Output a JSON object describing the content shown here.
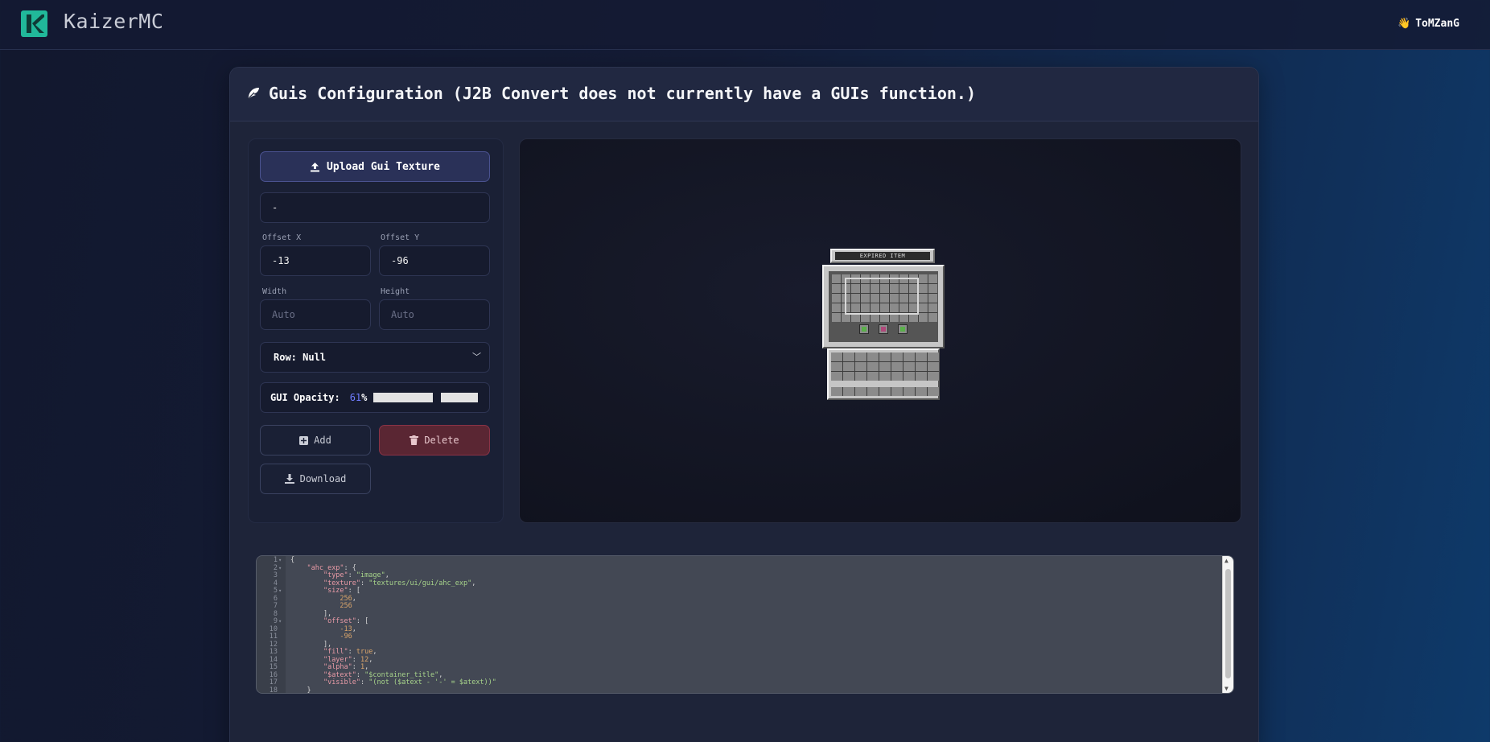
{
  "header": {
    "brand": "KaizerMC",
    "user": "ToMZanG",
    "user_icon": "wave-hand-icon",
    "accent_color": "#21b89a"
  },
  "card": {
    "title": "Guis Configuration (J2B Convert does not currently have a GUIs function.)",
    "title_icon": "feather-icon"
  },
  "panel": {
    "upload_label": "Upload Gui Texture",
    "name_value": "-",
    "offset_x_label": "Offset X",
    "offset_x_value": "-13",
    "offset_y_label": "Offset Y",
    "offset_y_value": "-96",
    "width_label": "Width",
    "width_placeholder": "Auto",
    "height_label": "Height",
    "height_placeholder": "Auto",
    "row_select": "Row: Null",
    "opacity_label": "GUI Opacity:",
    "opacity_value": "61",
    "opacity_unit": "%",
    "add_label": "Add",
    "delete_label": "Delete",
    "download_label": "Download",
    "delete_color": "#8a3346"
  },
  "preview": {
    "gui_title": "EXPIRED ITEM"
  },
  "editor": {
    "lines": [
      {
        "n": "1",
        "fold": "▾",
        "html": "{"
      },
      {
        "n": "2",
        "fold": "▾",
        "html": "    <span class='k'>\"ahc_exp\"</span>: {"
      },
      {
        "n": "3",
        "fold": "",
        "html": "        <span class='k'>\"type\"</span>: <span class='s'>\"image\"</span>,"
      },
      {
        "n": "4",
        "fold": "",
        "html": "        <span class='k'>\"texture\"</span>: <span class='s'>\"textures/ui/gui/ahc_exp\"</span>,"
      },
      {
        "n": "5",
        "fold": "▾",
        "html": "        <span class='k'>\"size\"</span>: ["
      },
      {
        "n": "6",
        "fold": "",
        "html": "            <span class='n'>256</span>,"
      },
      {
        "n": "7",
        "fold": "",
        "html": "            <span class='n'>256</span>"
      },
      {
        "n": "8",
        "fold": "",
        "html": "        ],"
      },
      {
        "n": "9",
        "fold": "▾",
        "html": "        <span class='k'>\"offset\"</span>: ["
      },
      {
        "n": "10",
        "fold": "",
        "html": "            <span class='n'>-13</span>,"
      },
      {
        "n": "11",
        "fold": "",
        "html": "            <span class='n'>-96</span>"
      },
      {
        "n": "12",
        "fold": "",
        "html": "        ],"
      },
      {
        "n": "13",
        "fold": "",
        "html": "        <span class='k'>\"fill\"</span>: <span class='b'>true</span>,"
      },
      {
        "n": "14",
        "fold": "",
        "html": "        <span class='k'>\"layer\"</span>: <span class='n'>12</span>,"
      },
      {
        "n": "15",
        "fold": "",
        "html": "        <span class='k'>\"alpha\"</span>: <span class='n'>1</span>,"
      },
      {
        "n": "16",
        "fold": "",
        "html": "        <span class='k'>\"$atext\"</span>: <span class='s'>\"$container_title\"</span>,"
      },
      {
        "n": "17",
        "fold": "",
        "html": "        <span class='k'>\"visible\"</span>: <span class='s'>\"(not ($atext - '-' = $atext))\"</span>"
      },
      {
        "n": "18",
        "fold": "",
        "html": "    }"
      }
    ]
  }
}
